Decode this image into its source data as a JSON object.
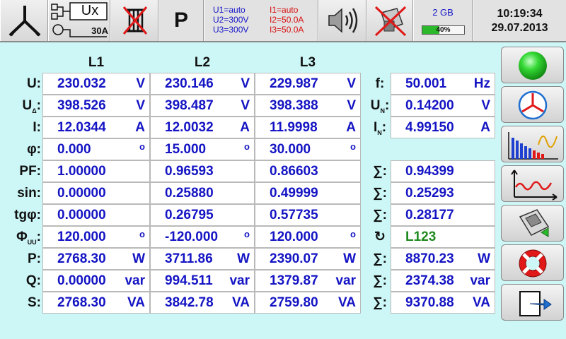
{
  "header": {
    "ux_label": "Ux",
    "current_range": "30A",
    "mode": "P",
    "u_status": [
      "U1=auto",
      "U2=300V",
      "U3=300V"
    ],
    "i_status": [
      "I1=auto",
      "I2=50.0A",
      "I3=50.0A"
    ],
    "memory": {
      "label": "2 GB",
      "percent_label": "40%",
      "fill": 0.4
    },
    "time": "10:19:34",
    "date": "29.07.2013"
  },
  "columns": [
    "L1",
    "L2",
    "L3"
  ],
  "rows": [
    {
      "label": "U:",
      "values": [
        "230.032",
        "230.146",
        "229.987"
      ],
      "unit": "V",
      "side": {
        "label": "f:",
        "value": "50.001",
        "unit": "Hz"
      }
    },
    {
      "label": "U",
      "label_sub": "Δ",
      "label_tail": ":",
      "values": [
        "398.526",
        "398.487",
        "398.388"
      ],
      "unit": "V",
      "side": {
        "label": "U",
        "label_sub": "N",
        "label_tail": ":",
        "value": "0.14200",
        "unit": "V"
      }
    },
    {
      "label": "I:",
      "values": [
        "12.0344",
        "12.0032",
        "11.9998"
      ],
      "unit": "A",
      "side": {
        "label": "I",
        "label_sub": "N",
        "label_tail": ":",
        "value": "4.99150",
        "unit": "A"
      }
    },
    {
      "label": "φ:",
      "values": [
        "0.000",
        "15.000",
        "30.000"
      ],
      "unit": "o"
    },
    {
      "label": "PF:",
      "values": [
        "1.00000",
        "0.96593",
        "0.86603"
      ],
      "unit": "",
      "side": {
        "label": "∑:",
        "value": "0.94399",
        "unit": ""
      }
    },
    {
      "label": "sin:",
      "values": [
        "0.00000",
        "0.25880",
        "0.49999"
      ],
      "unit": "",
      "side": {
        "label": "∑:",
        "value": "0.25293",
        "unit": ""
      }
    },
    {
      "label": "tgφ:",
      "values": [
        "0.00000",
        "0.26795",
        "0.57735"
      ],
      "unit": "",
      "side": {
        "label": "∑:",
        "value": "0.28177",
        "unit": ""
      }
    },
    {
      "label": "Φ",
      "label_sub": "UU",
      "label_tail": ":",
      "values": [
        "120.000",
        "-120.000",
        "120.000"
      ],
      "unit": "o",
      "side": {
        "label": "↻",
        "value": "L123",
        "unit": "",
        "green": true
      }
    },
    {
      "label": "P:",
      "values": [
        "2768.30",
        "3711.86",
        "2390.07"
      ],
      "unit": "W",
      "side": {
        "label": "∑:",
        "value": "8870.23",
        "unit": "W"
      }
    },
    {
      "label": "Q:",
      "values": [
        "0.00000",
        "994.511",
        "1379.87"
      ],
      "unit": "var",
      "side": {
        "label": "∑:",
        "value": "2374.38",
        "unit": "var"
      }
    },
    {
      "label": "S:",
      "values": [
        "2768.30",
        "3842.78",
        "2759.80"
      ],
      "unit": "VA",
      "side": {
        "label": "∑:",
        "value": "9370.88",
        "unit": "VA"
      }
    }
  ],
  "icons": {
    "topbar": [
      "wiring-star-icon",
      "input-config-icon",
      "transformer-disabled-icon",
      "speaker-icon",
      "usb-disabled-icon"
    ],
    "sidebar": [
      "status-ok-icon",
      "phasor-diagram-icon",
      "harmonics-icon",
      "waveform-icon",
      "record-icon",
      "help-icon",
      "exit-icon"
    ]
  },
  "colors": {
    "value": "#1414c4",
    "status_ok": "#2fd02f",
    "alert": "#e01818",
    "background": "#cdf6f6"
  }
}
